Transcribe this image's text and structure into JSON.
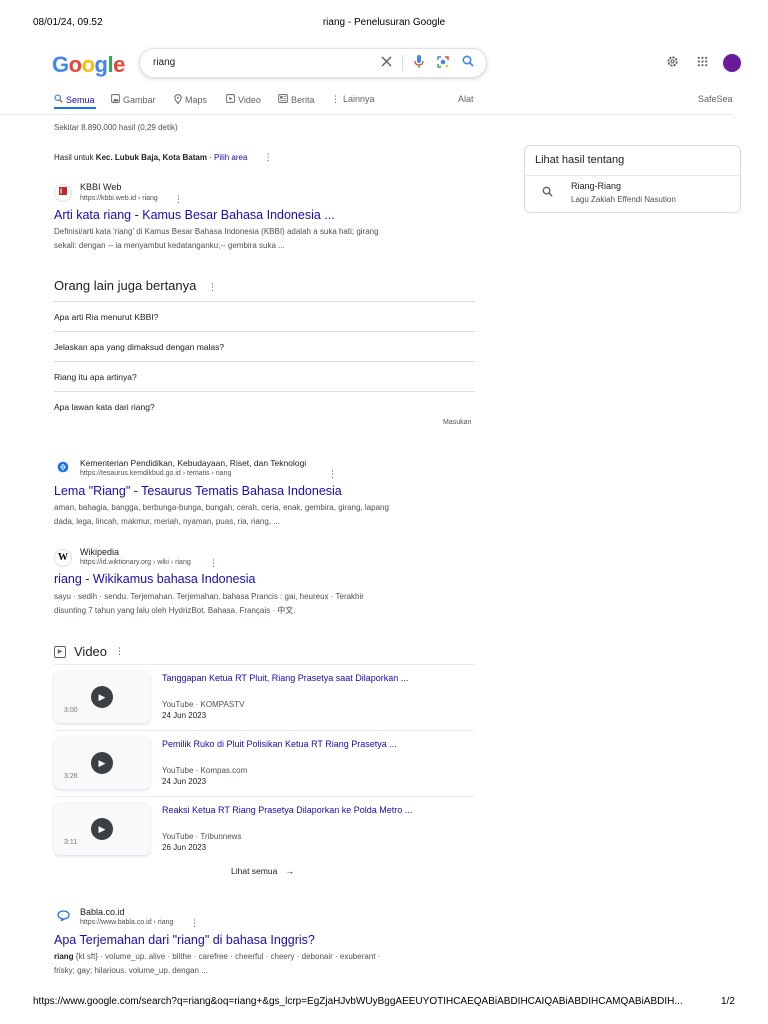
{
  "print": {
    "date": "08/01/24, 09.52",
    "doc_title": "riang - Penelusuran Google",
    "url": "https://www.google.com/search?q=riang&oq=riang+&gs_lcrp=EgZjaHJvbWUyBggAEEUYOTIHCAEQABiABDIHCAIQABiABDIHCAMQABiABDIH...",
    "page_num": "1/2"
  },
  "logo": {
    "letters": [
      "G",
      "o",
      "o",
      "g",
      "l",
      "e"
    ],
    "colors": [
      "#4285f4",
      "#ea4335",
      "#fbbc05",
      "#4285f4",
      "#34a853",
      "#ea4335"
    ]
  },
  "search": {
    "query": "riang"
  },
  "icons": {
    "clear": "close-icon",
    "voice": "microphone-icon",
    "lens": "camera-lens-icon",
    "search": "search-icon",
    "settings": "gear-icon",
    "apps": "apps-grid-icon"
  },
  "tabs": [
    {
      "label": "Semua",
      "icon": "search-icon",
      "active": true
    },
    {
      "label": "Gambar",
      "icon": "image-icon"
    },
    {
      "label": "Maps",
      "icon": "map-pin-icon"
    },
    {
      "label": "Video",
      "icon": "video-icon"
    },
    {
      "label": "Berita",
      "icon": "news-icon"
    },
    {
      "label": "Lainnya",
      "icon": "more-vert-icon"
    },
    {
      "label": "Alat"
    },
    {
      "label": "SafeSea"
    }
  ],
  "stats": "Sekitar 8.890.000 hasil (0,29 detik)",
  "location": {
    "prefix": "Hasil untuk ",
    "place": "Kec. Lubuk Baja, Kota Batam",
    "separator": " · ",
    "link": "Pilih area"
  },
  "results": [
    {
      "site": "KBBI Web",
      "url": "https://kbbi.web.id › riang",
      "title": "Arti kata riang - Kamus Besar Bahasa Indonesia ...",
      "snippet": [
        "Definisi/arti kata 'riang' di Kamus Besar Bahasa Indonesia (KBBI) adalah a suka hati; girang",
        "sekali: dengan -- ia menyambut kedatanganku;-- gembira suka ..."
      ]
    },
    {
      "site": "Kementerian Pendidikan, Kebudayaan, Riset, dan Teknologi",
      "url": "https://tesaurus.kemdikbud.go.id › tematis › riang",
      "title": "Lema \"Riang\" - Tesaurus Tematis Bahasa Indonesia",
      "snippet": [
        "aman, bahagia, bangga, berbunga-bunga, bungah, cerah, ceria, enak, gembira, girang, lapang",
        "dada, lega, lincah, makmur, meriah, nyaman, puas, ria, riang, ..."
      ]
    },
    {
      "site": "Wikipedia",
      "url": "https://id.wiktionary.org › wiki › riang",
      "title": "riang - Wikikamus bahasa Indonesia",
      "snippet": [
        "sayu · sedih · sendu. Terjemahan. Terjemahan. bahasa Prancis : gai, heureux · Terakhir",
        "disunting 7 tahun yang lalu oleh HydrizBot. Bahasa. Français · 中文."
      ]
    },
    {
      "site": "Babla.co.id",
      "url": "https://www.babla.co.id › riang",
      "title": "Apa Terjemahan dari \"riang\" di bahasa Inggris?",
      "snippet_bold": "riang",
      "snippet": [
        " {kt sft} · volume_up. alive · blithe · carefree · cheerful · cheery · debonair · exuberant ·",
        "frisky; gay; hilarious. volume_up. dengan ..."
      ]
    }
  ],
  "paa": {
    "heading": "Orang lain juga bertanya",
    "questions": [
      "Apa arti Ria menurut KBBI?",
      "Jelaskan apa yang dimaksud dengan malas?",
      "Riang itu apa artinya?",
      "Apa lawan kata dari riang?"
    ],
    "feedback": "Masukan"
  },
  "knowledge": {
    "title": "Lihat hasil tentang",
    "name": "Riang-Riang",
    "subtitle": "Lagu Zakiah Effendi Nasution"
  },
  "videos": {
    "heading": "Video",
    "items": [
      {
        "title": "Tanggapan Ketua RT Pluit, Riang Prasetya saat Dilaporkan ...",
        "source": "YouTube · KOMPASTV",
        "date": "24 Jun 2023",
        "duration": "3:00"
      },
      {
        "title": "Pemilik Ruko di Pluit Polisikan Ketua RT Riang Prasetya ...",
        "source": "YouTube · Kompas.com",
        "date": "24 Jun 2023",
        "duration": "3:26"
      },
      {
        "title": "Reaksi Ketua RT Riang Prasetya Dilaporkan ke Polda Metro ...",
        "source": "YouTube · Tribunnews",
        "date": "26 Jun 2023",
        "duration": "3:11"
      }
    ],
    "see_all": "Lihat semua"
  }
}
